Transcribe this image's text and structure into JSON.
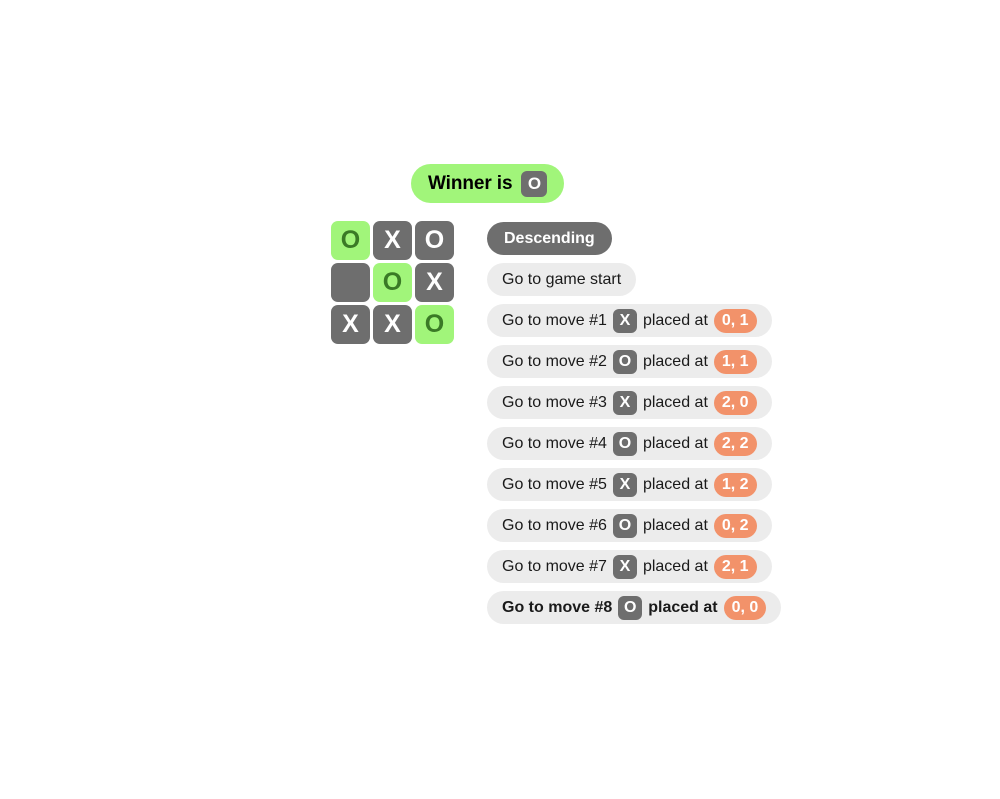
{
  "status": {
    "prefix": "Winner is",
    "winner": "O"
  },
  "board": {
    "rows": [
      [
        {
          "value": "O",
          "winning": true,
          "row": 0,
          "col": 0
        },
        {
          "value": "X",
          "winning": false,
          "row": 0,
          "col": 1
        },
        {
          "value": "O",
          "winning": false,
          "row": 0,
          "col": 2
        }
      ],
      [
        {
          "value": "",
          "winning": false,
          "row": 1,
          "col": 0
        },
        {
          "value": "O",
          "winning": true,
          "row": 1,
          "col": 1
        },
        {
          "value": "X",
          "winning": false,
          "row": 1,
          "col": 2
        }
      ],
      [
        {
          "value": "X",
          "winning": false,
          "row": 2,
          "col": 0
        },
        {
          "value": "X",
          "winning": false,
          "row": 2,
          "col": 1
        },
        {
          "value": "O",
          "winning": true,
          "row": 2,
          "col": 2
        }
      ]
    ]
  },
  "moves": {
    "sort_label": "Descending",
    "game_start_label": "Go to game start",
    "items": [
      {
        "label": "Go to move #1",
        "player": "X",
        "placed_label": "placed at",
        "coords": "0, 1",
        "current": false
      },
      {
        "label": "Go to move #2",
        "player": "O",
        "placed_label": "placed at",
        "coords": "1, 1",
        "current": false
      },
      {
        "label": "Go to move #3",
        "player": "X",
        "placed_label": "placed at",
        "coords": "2, 0",
        "current": false
      },
      {
        "label": "Go to move #4",
        "player": "O",
        "placed_label": "placed at",
        "coords": "2, 2",
        "current": false
      },
      {
        "label": "Go to move #5",
        "player": "X",
        "placed_label": "placed at",
        "coords": "1, 2",
        "current": false
      },
      {
        "label": "Go to move #6",
        "player": "O",
        "placed_label": "placed at",
        "coords": "0, 2",
        "current": false
      },
      {
        "label": "Go to move #7",
        "player": "X",
        "placed_label": "placed at",
        "coords": "2, 1",
        "current": false
      },
      {
        "label": "Go to move #8",
        "player": "O",
        "placed_label": "placed at",
        "coords": "0, 0",
        "current": true
      }
    ]
  },
  "colors": {
    "win_highlight": "#a1f57a",
    "win_mark": "#3a7a26",
    "cell": "#6e6e6e",
    "pill": "#ececec",
    "coord_badge": "#f2926a",
    "sort_button": "#6e6e6e"
  }
}
